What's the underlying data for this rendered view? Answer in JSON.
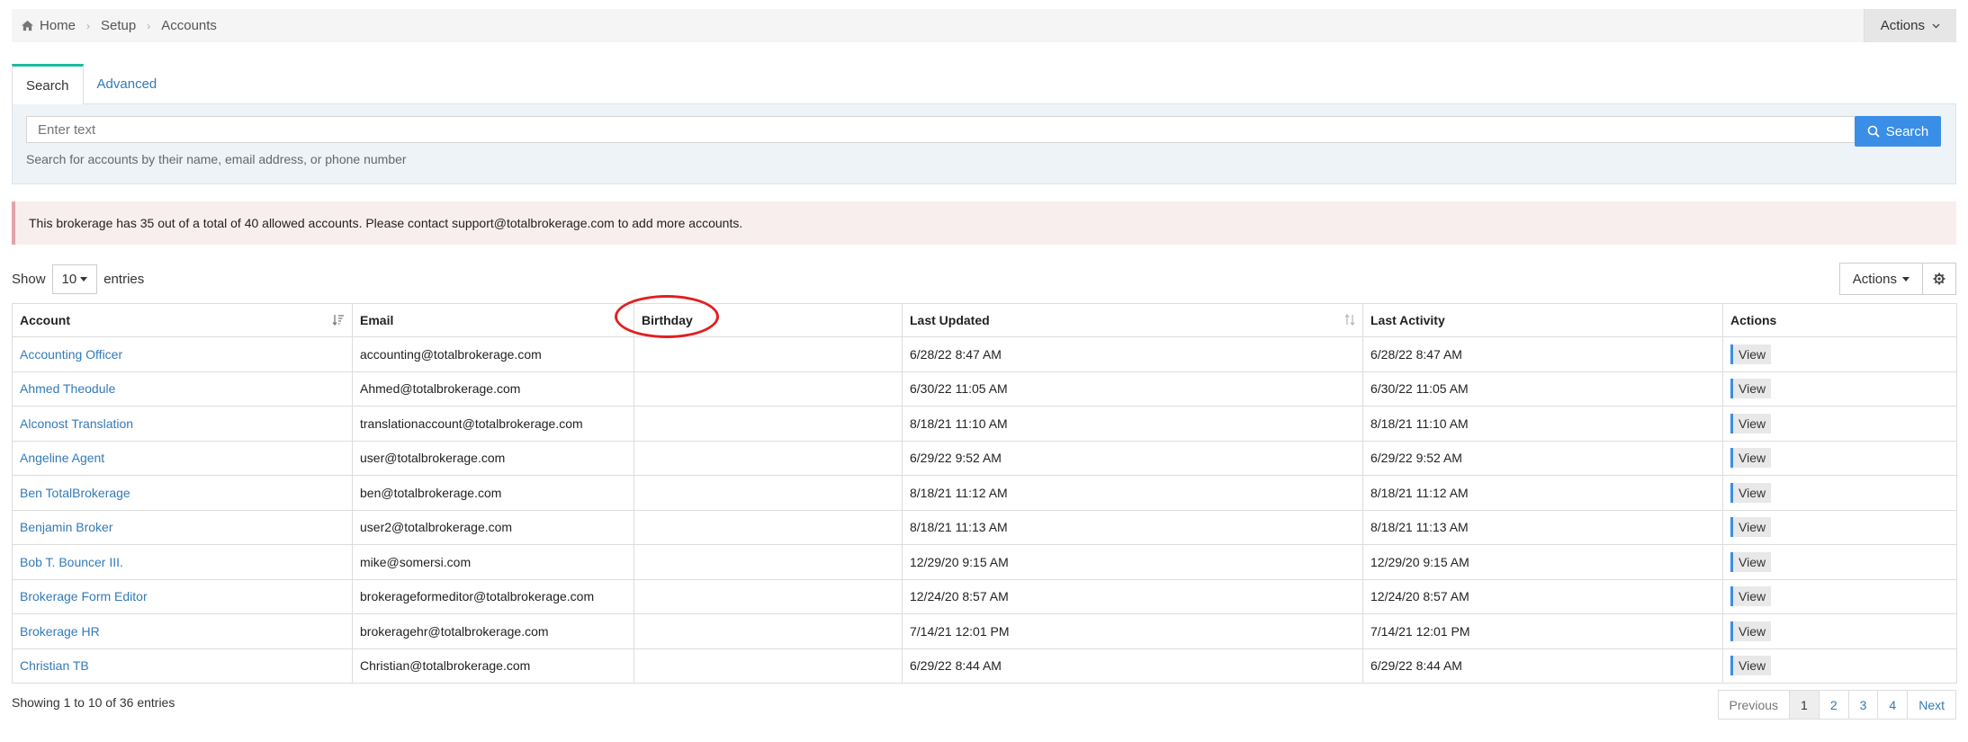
{
  "breadcrumb": {
    "home": "Home",
    "setup": "Setup",
    "accounts": "Accounts"
  },
  "top_actions_label": "Actions",
  "tabs": [
    {
      "label": "Search"
    },
    {
      "label": "Advanced"
    }
  ],
  "search": {
    "placeholder": "Enter text",
    "button_label": "Search",
    "help": "Search for accounts by their name, email address, or phone number"
  },
  "alert": "This brokerage has 35 out of a total of 40 allowed accounts. Please contact support@totalbrokerage.com to add more accounts.",
  "length": {
    "show": "Show",
    "value": "10",
    "entries": "entries"
  },
  "table_actions_label": "Actions",
  "columns": [
    "Account",
    "Email",
    "Birthday",
    "Last Updated",
    "Last Activity",
    "Actions"
  ],
  "rows": [
    {
      "account": "Accounting Officer",
      "email": "accounting@totalbrokerage.com",
      "birthday": "",
      "updated": "6/28/22 8:47 AM",
      "activity": "6/28/22 8:47 AM",
      "action": "View"
    },
    {
      "account": "Ahmed Theodule",
      "email": "Ahmed@totalbrokerage.com",
      "birthday": "",
      "updated": "6/30/22 11:05 AM",
      "activity": "6/30/22 11:05 AM",
      "action": "View"
    },
    {
      "account": "Alconost Translation",
      "email": "translationaccount@totalbrokerage.com",
      "birthday": "",
      "updated": "8/18/21 11:10 AM",
      "activity": "8/18/21 11:10 AM",
      "action": "View"
    },
    {
      "account": "Angeline Agent",
      "email": "user@totalbrokerage.com",
      "birthday": "",
      "updated": "6/29/22 9:52 AM",
      "activity": "6/29/22 9:52 AM",
      "action": "View"
    },
    {
      "account": "Ben TotalBrokerage",
      "email": "ben@totalbrokerage.com",
      "birthday": "",
      "updated": "8/18/21 11:12 AM",
      "activity": "8/18/21 11:12 AM",
      "action": "View"
    },
    {
      "account": "Benjamin Broker",
      "email": "user2@totalbrokerage.com",
      "birthday": "",
      "updated": "8/18/21 11:13 AM",
      "activity": "8/18/21 11:13 AM",
      "action": "View"
    },
    {
      "account": "Bob T. Bouncer III.",
      "email": "mike@somersi.com",
      "birthday": "",
      "updated": "12/29/20 9:15 AM",
      "activity": "12/29/20 9:15 AM",
      "action": "View"
    },
    {
      "account": "Brokerage Form Editor",
      "email": "brokerageformeditor@totalbrokerage.com",
      "birthday": "",
      "updated": "12/24/20 8:57 AM",
      "activity": "12/24/20 8:57 AM",
      "action": "View"
    },
    {
      "account": "Brokerage HR",
      "email": "brokeragehr@totalbrokerage.com",
      "birthday": "",
      "updated": "7/14/21 12:01 PM",
      "activity": "7/14/21 12:01 PM",
      "action": "View"
    },
    {
      "account": "Christian TB",
      "email": "Christian@totalbrokerage.com",
      "birthday": "",
      "updated": "6/29/22 8:44 AM",
      "activity": "6/29/22 8:44 AM",
      "action": "View"
    }
  ],
  "info": "Showing 1 to 10 of 36 entries",
  "pagination": {
    "previous": "Previous",
    "pages": [
      "1",
      "2",
      "3",
      "4"
    ],
    "next": "Next",
    "current": "1"
  },
  "colors": {
    "accent": "#3a8ee6",
    "link": "#337ab7",
    "tab_active": "#1abc9c",
    "alert_border": "#e3a3a8",
    "highlight": "#e02020"
  },
  "icons": {
    "home": "home-icon",
    "search": "search-icon",
    "settings": "gear-icon",
    "sort": "sort-icon",
    "dropdown": "caret-down-icon"
  }
}
